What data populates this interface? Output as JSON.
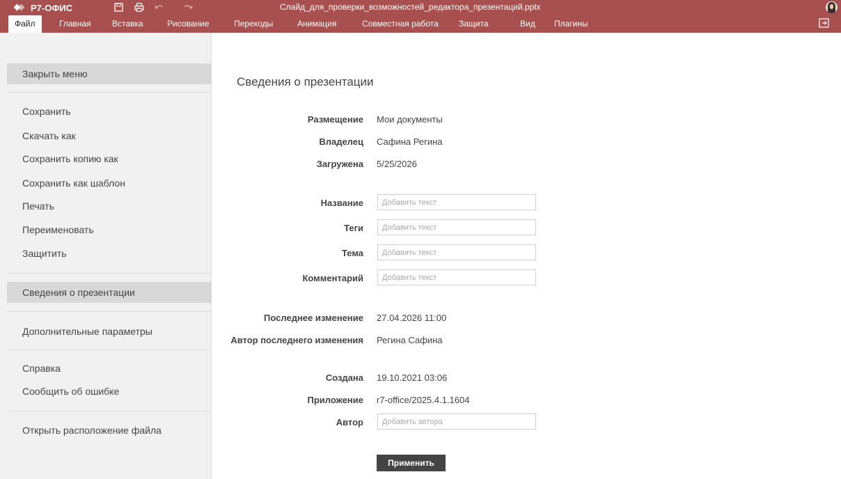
{
  "header": {
    "app_name": "Р7-ОФИС",
    "doc_title": "Слайд_для_проверки_возможностей_редактора_презентаций.pptx",
    "quick_actions": [
      "save-icon",
      "print-icon",
      "undo-icon",
      "redo-icon"
    ],
    "accent_color": "#a85050"
  },
  "tabs": [
    {
      "label": "Файл",
      "active": true
    },
    {
      "label": "Главная"
    },
    {
      "label": "Вставка"
    },
    {
      "label": "Рисование"
    },
    {
      "label": "Переходы"
    },
    {
      "label": "Анимация"
    },
    {
      "label": "Совместная работа"
    },
    {
      "label": "Защита"
    },
    {
      "label": "Вид"
    },
    {
      "label": "Плагины"
    }
  ],
  "menu": {
    "close": "Закрыть меню",
    "save": "Сохранить",
    "download_as": "Скачать как",
    "save_copy_as": "Сохранить копию как",
    "save_as_template": "Сохранить как шаблон",
    "print": "Печать",
    "rename": "Переименовать",
    "protect": "Защитить",
    "info": "Сведения о презентации",
    "advanced": "Дополнительные параметры",
    "help": "Справка",
    "report_bug": "Сообщить об ошибке",
    "open_location": "Открыть расположение файла"
  },
  "info": {
    "title": "Сведения о презентации",
    "location_label": "Размещение",
    "location_value": "Мои документы",
    "owner_label": "Владелец",
    "owner_value": "Сафина Регина",
    "uploaded_label": "Загружена",
    "uploaded_value": "5/25/2026",
    "name_label": "Название",
    "tags_label": "Теги",
    "subject_label": "Тема",
    "comment_label": "Комментарий",
    "text_placeholder": "Добавить текст",
    "modified_label": "Последнее изменение",
    "modified_value": "27.04.2026 11:00",
    "modified_by_label": "Автор последнего изменения",
    "modified_by_value": "Регина Сафина",
    "created_label": "Создана",
    "created_value": "19.10.2021 03:06",
    "application_label": "Приложение",
    "application_value": "r7-office/2025.4.1.1604",
    "author_label": "Автор",
    "author_placeholder": "Добавить автора",
    "apply_label": "Применить"
  }
}
